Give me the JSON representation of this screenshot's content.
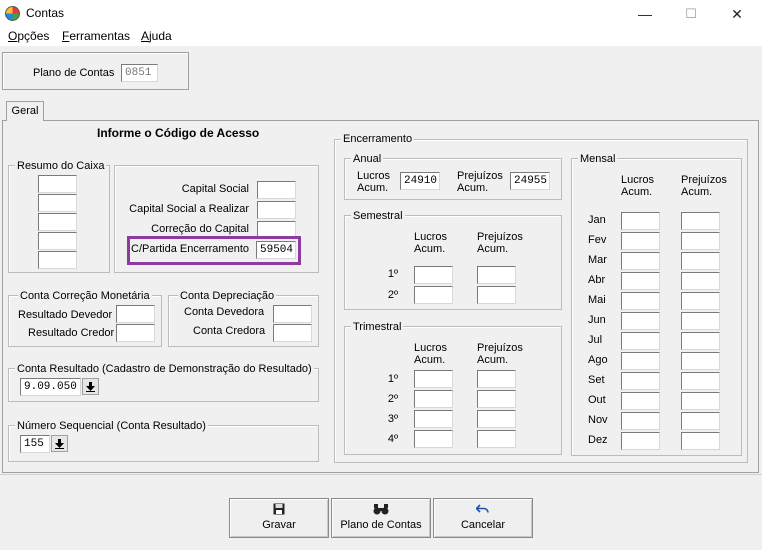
{
  "window": {
    "title": "Contas",
    "minimize": "—",
    "maximize": "☐",
    "close": "✕"
  },
  "menu": [
    {
      "label_underline": "O",
      "label_rest": "pções"
    },
    {
      "label_underline": "F",
      "label_rest": "erramentas"
    },
    {
      "label_underline": "A",
      "label_rest": "juda"
    }
  ],
  "plano": {
    "label": "Plano de Contas",
    "value": "0851"
  },
  "tab": {
    "label": "Geral"
  },
  "header": {
    "title": "Informe o Código de Acesso"
  },
  "resumo": {
    "title": "Resumo do Caixa"
  },
  "capital": {
    "items": [
      {
        "label": "Capital Social",
        "value": ""
      },
      {
        "label": "Capital Social a Realizar",
        "value": ""
      },
      {
        "label": "Correção do Capital",
        "value": ""
      },
      {
        "label": "C/Partida Encerramento",
        "value": "59504"
      }
    ]
  },
  "correcao": {
    "title": "Conta Correção Monetária",
    "devedor": "Resultado Devedor",
    "credor": "Resultado Credor"
  },
  "depreciacao": {
    "title": "Conta Depreciação",
    "devedora": "Conta Devedora",
    "credora": "Conta Credora"
  },
  "resultado": {
    "title": "Conta Resultado (Cadastro de Demonstração do Resultado)",
    "value": "9.09.050"
  },
  "sequencial": {
    "title": "Número Sequencial (Conta Resultado)",
    "value": "155"
  },
  "encerramento": {
    "title": "Encerramento",
    "anual": {
      "title": "Anual",
      "lucros_1": "Lucros",
      "lucros_2": "Acum.",
      "lucros_value": "24910",
      "prej_1": "Prejuízos",
      "prej_2": "Acum.",
      "prej_value": "24955"
    },
    "semestral": {
      "title": "Semestral",
      "lucros_1": "Lucros",
      "lucros_2": "Acum.",
      "prej_1": "Prejuízos",
      "prej_2": "Acum.",
      "rows": [
        "1º",
        "2º"
      ]
    },
    "trimestral": {
      "title": "Trimestral",
      "lucros_1": "Lucros",
      "lucros_2": "Acum.",
      "prej_1": "Prejuízos",
      "prej_2": "Acum.",
      "rows": [
        "1º",
        "2º",
        "3º",
        "4º"
      ]
    },
    "mensal": {
      "title": "Mensal",
      "lucros_1": "Lucros",
      "lucros_2": "Acum.",
      "prej_1": "Prejuízos",
      "prej_2": "Acum.",
      "months": [
        "Jan",
        "Fev",
        "Mar",
        "Abr",
        "Mai",
        "Jun",
        "Jul",
        "Ago",
        "Set",
        "Out",
        "Nov",
        "Dez"
      ]
    }
  },
  "buttons": {
    "gravar": {
      "label": "Gravar",
      "icon": "floppy-disk-icon"
    },
    "plano": {
      "label": "Plano de Contas",
      "icon": "binoculars-icon"
    },
    "cancelar": {
      "label": "Cancelar",
      "icon": "undo-arrow-icon"
    }
  },
  "colors": {
    "highlight": "#8e3ba0"
  }
}
